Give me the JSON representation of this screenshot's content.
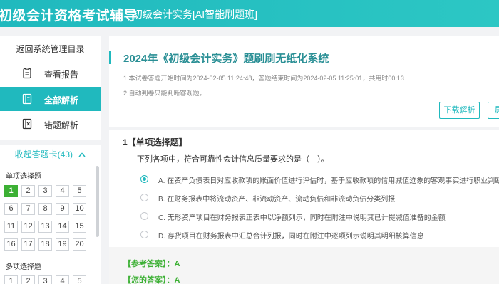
{
  "header": {
    "app_title": "初级会计资格考试辅导",
    "course_title": "初级会计实务[AI智能刷题班]"
  },
  "sidebar": {
    "return_label": "返回系统管理目录",
    "items": [
      {
        "label": "查看报告",
        "icon": "report-icon",
        "active": false
      },
      {
        "label": "全部解析",
        "icon": "analysis-icon",
        "active": true
      },
      {
        "label": "错题解析",
        "icon": "wrong-answers-icon",
        "active": false
      }
    ],
    "collapse_label": "收起答题卡(43)",
    "sections": [
      {
        "label": "单项选择题",
        "numbers": [
          "1",
          "2",
          "3",
          "4",
          "5",
          "6",
          "7",
          "8",
          "9",
          "10",
          "11",
          "12",
          "13",
          "14",
          "15",
          "16",
          "17",
          "18",
          "19",
          "20"
        ]
      },
      {
        "label": "多项选择题",
        "numbers": [
          "1",
          "2",
          "3",
          "4",
          "5"
        ]
      }
    ],
    "current_question": "1"
  },
  "exam": {
    "title": "2024年《初级会计实务》题刷刷无纸化系统",
    "info_line_1": "1.本试卷答题开始时间为2024-02-05 11:24:48，答题结束时间为2024-02-05 11:25:01，共用时00:13",
    "info_line_2": "2.自动判卷只能判断客观题。",
    "download_button": "下载解析",
    "second_button": "屏"
  },
  "question": {
    "type_label": "1【单项选择题】",
    "stem": "下列各项中，符合可靠性会计信息质量要求的是（　）。",
    "options": [
      {
        "text": "A. 在资产负债表日对应收款项的账面价值进行评估时，基于应收款项的信用减值迹象的客观事实进行职业判断",
        "selected": true
      },
      {
        "text": "B. 在财务报表中将流动资产、非流动资产、流动负债和非流动负债分类列报",
        "selected": false
      },
      {
        "text": "C. 无形资产项目在财务报表正表中以净额列示，同时在附注中说明其已计提减值准备的金额",
        "selected": false
      },
      {
        "text": "D. 存货项目在财务报表中汇总合计列报，同时在附注中逐项列示说明其明细核算信息",
        "selected": false
      }
    ],
    "reference_answer_label": "【参考答案】：A",
    "your_answer_label": "【您的答案】：A"
  }
}
